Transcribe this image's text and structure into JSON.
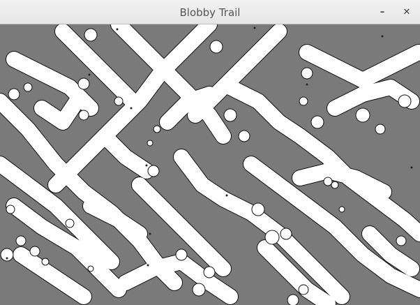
{
  "window": {
    "title": "Blobby Trail",
    "minimize_icon": "minimize-icon",
    "close_icon": "close-icon",
    "minimize_glyph": "–",
    "close_glyph": "✕"
  },
  "board": {
    "background": "#7a7a7a",
    "trail_color": "#ffffff",
    "outline_color": "#111111"
  }
}
